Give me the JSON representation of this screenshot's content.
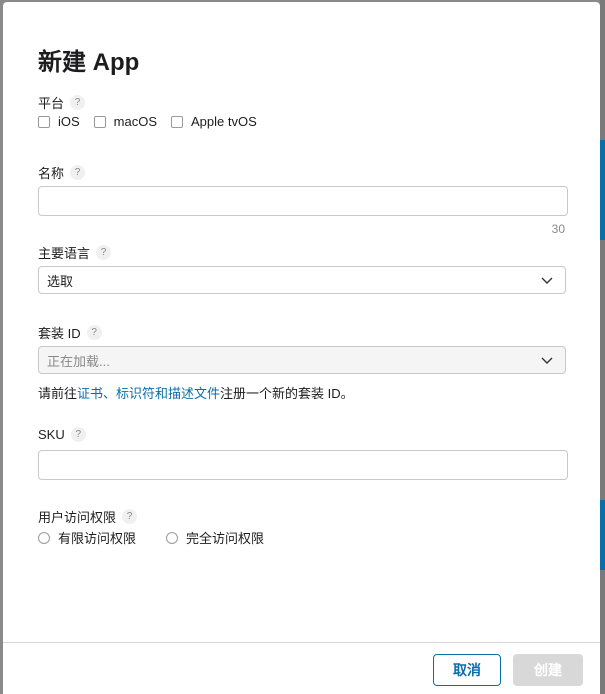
{
  "dialog": {
    "title": "新建 App"
  },
  "platform": {
    "label": "平台",
    "help": "?",
    "options": [
      "iOS",
      "macOS",
      "Apple tvOS"
    ]
  },
  "name": {
    "label": "名称",
    "help": "?",
    "value": "",
    "counter": "30"
  },
  "primary_language": {
    "label": "主要语言",
    "help": "?",
    "selected": "选取"
  },
  "bundle_id": {
    "label": "套装 ID",
    "help": "?",
    "selected": "正在加载...",
    "note_prefix": "请前往",
    "note_link": "证书、标识符和描述文件",
    "note_suffix": "注册一个新的套装 ID。"
  },
  "sku": {
    "label": "SKU",
    "help": "?",
    "value": ""
  },
  "user_access": {
    "label": "用户访问权限",
    "help": "?",
    "options": [
      "有限访问权限",
      "完全访问权限"
    ]
  },
  "footer": {
    "cancel_label": "取消",
    "create_label": "创建"
  },
  "colors": {
    "accent": "#0b6ea8",
    "disabled_button": "#d8d8d8"
  }
}
